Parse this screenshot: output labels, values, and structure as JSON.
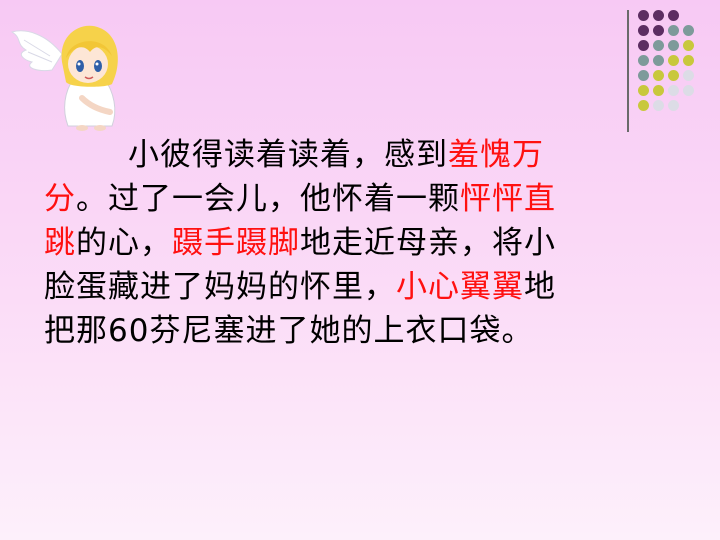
{
  "slide": {
    "lines": [
      [
        {
          "t": "小彼得读着读着，感到",
          "red": false
        },
        {
          "t": "羞愧万",
          "red": true
        }
      ],
      [
        {
          "t": "分",
          "red": true
        },
        {
          "t": "。过了一会儿，他怀着一颗",
          "red": false
        },
        {
          "t": "怦怦直",
          "red": true
        }
      ],
      [
        {
          "t": "跳",
          "red": true
        },
        {
          "t": "的心，",
          "red": false
        },
        {
          "t": "蹑手蹑脚",
          "red": true
        },
        {
          "t": "地走近母亲，将小",
          "red": false
        }
      ],
      [
        {
          "t": "脸蛋藏进了妈妈的怀里，",
          "red": false
        },
        {
          "t": "小心翼翼",
          "red": true
        },
        {
          "t": "地",
          "red": false
        }
      ],
      [
        {
          "t": "把那60芬尼塞进了她的上衣口袋。",
          "red": false
        }
      ]
    ]
  },
  "decor": {
    "angel_icon": "angel-icon",
    "dot_colors": [
      "#5c2d62",
      "#7d9a9a",
      "#c8c83c",
      "#dcdce6"
    ],
    "line_color": "#6a6a6a",
    "highlight_color": "#ff1010"
  }
}
